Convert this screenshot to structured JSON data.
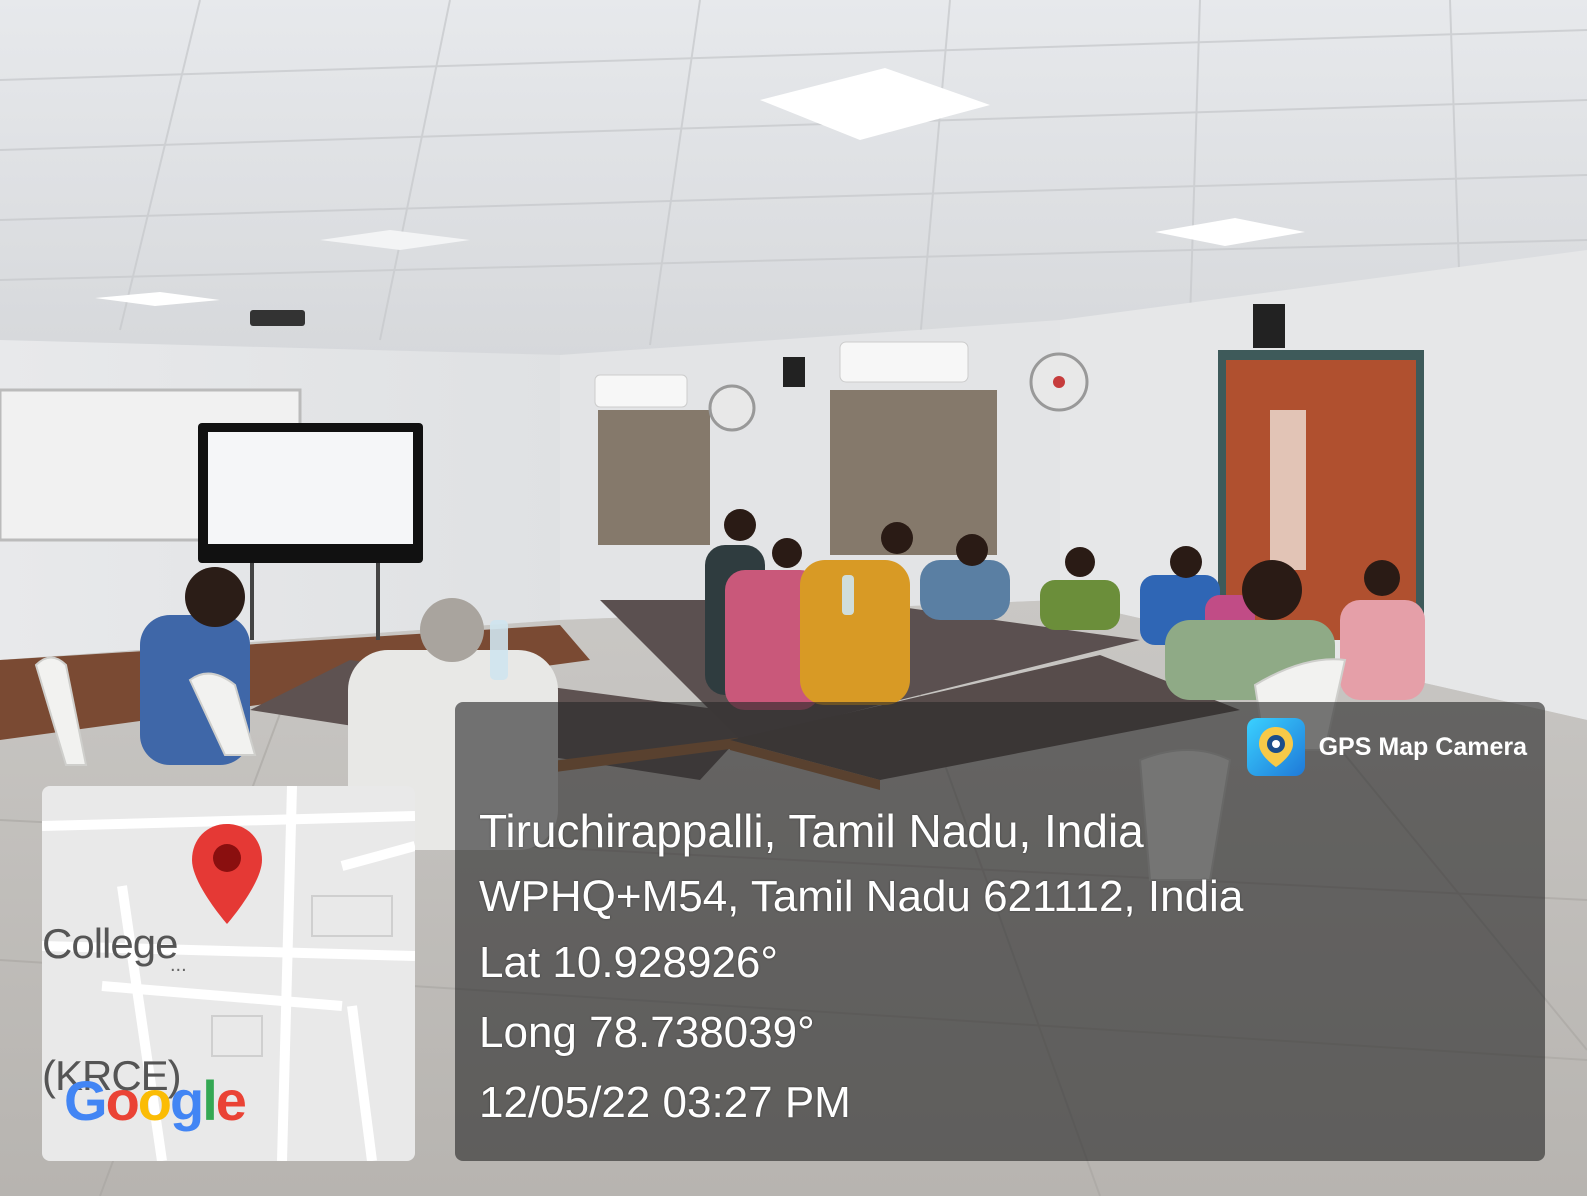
{
  "overlay": {
    "app_name": "GPS Map Camera",
    "city_line": "Tiruchirappalli, Tamil Nadu, India",
    "address_line": "WPHQ+M54, Tamil Nadu 621112, India",
    "lat_line": "Lat 10.928926°",
    "long_line": "Long 78.738039°",
    "datetime_line": "12/05/22 03:27 PM"
  },
  "map": {
    "label_line1": "College",
    "label_line2": "(KRCE)",
    "logo_text": "Google",
    "pin_color": "#e53935"
  }
}
